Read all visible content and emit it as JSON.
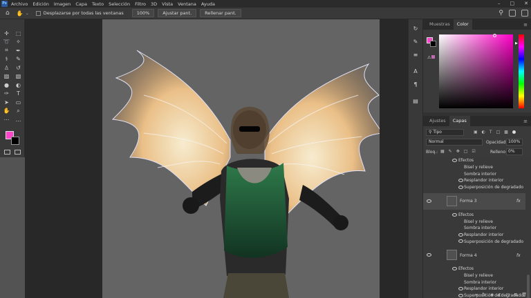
{
  "menubar": {
    "items": [
      "Archivo",
      "Edición",
      "Imagen",
      "Capa",
      "Texto",
      "Selección",
      "Filtro",
      "3D",
      "Vista",
      "Ventana",
      "Ayuda"
    ],
    "logo": "Ps"
  },
  "options": {
    "scroll_all_label": "Desplazarse por todas las ventanas",
    "zoom_btn": "100%",
    "fit_btn": "Ajustar pant.",
    "fill_btn": "Rellenar pant."
  },
  "tools": [
    "move-icon",
    "marquee-icon",
    "lasso-icon",
    "magic-wand-icon",
    "crop-icon",
    "eyedropper-icon",
    "healing-icon",
    "brush-icon",
    "stamp-icon",
    "history-brush-icon",
    "eraser-icon",
    "gradient-icon",
    "blur-icon",
    "dodge-icon",
    "pen-icon",
    "type-icon",
    "path-select-icon",
    "shape-icon",
    "hand-icon",
    "zoom-icon",
    "edit-toolbar-icon",
    "more-icon"
  ],
  "panels": {
    "top_tabs": [
      "Muestras",
      "Color"
    ],
    "top_active": "Color",
    "layer_tabs": [
      "Ajustes",
      "Capas"
    ],
    "layer_active": "Capas",
    "filter_label": "Tipo",
    "blend_mode": "Normal",
    "opacity_label": "Opacidad:",
    "opacity_value": "100%",
    "lock_label": "Bloq.:",
    "fill_label": "Relleno:",
    "fill_value": "0%"
  },
  "colors": {
    "foreground": "#ff44cc",
    "background": "#000000"
  },
  "layers": [
    {
      "name": "Efectos",
      "indent": 1
    },
    {
      "name": "Bisel y relieve",
      "indent": 2
    },
    {
      "name": "Sombra interior",
      "indent": 2
    },
    {
      "name": "Resplandor interior",
      "indent": 2
    },
    {
      "name": "Superposición de degradado",
      "indent": 2
    },
    {
      "name": "Forma 3",
      "indent": 0,
      "fx": "fx"
    },
    {
      "name": "Efectos",
      "indent": 1
    },
    {
      "name": "Bisel y relieve",
      "indent": 2
    },
    {
      "name": "Sombra interior",
      "indent": 2
    },
    {
      "name": "Resplandor interior",
      "indent": 2
    },
    {
      "name": "Superposición de degradado",
      "indent": 2
    },
    {
      "name": "Forma 4",
      "indent": 0,
      "fx": "fx"
    },
    {
      "name": "Efectos",
      "indent": 1
    },
    {
      "name": "Bisel y relieve",
      "indent": 2
    },
    {
      "name": "Sombra interior",
      "indent": 2
    },
    {
      "name": "Resplandor interior",
      "indent": 2
    },
    {
      "name": "Superposición de degradado",
      "indent": 2
    }
  ]
}
